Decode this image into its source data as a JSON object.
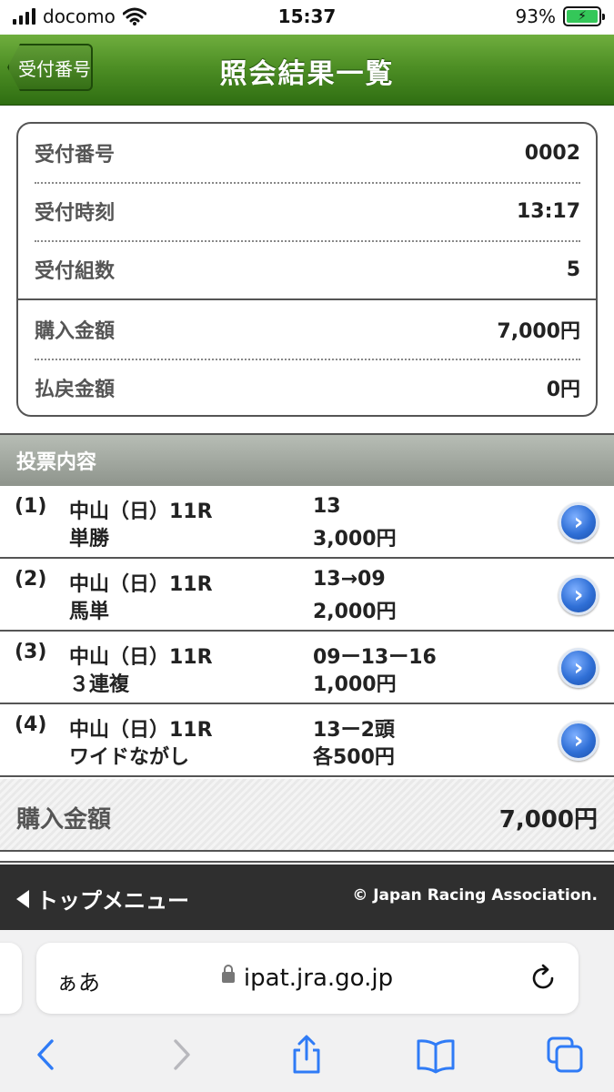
{
  "status": {
    "carrier": "docomo",
    "time": "15:37",
    "battery": "93%"
  },
  "header": {
    "back_label": "受付番号",
    "title": "照会結果一覧"
  },
  "summary": {
    "rows": [
      {
        "label": "受付番号",
        "value": "0002"
      },
      {
        "label": "受付時刻",
        "value": "13:17"
      },
      {
        "label": "受付組数",
        "value": "5"
      },
      {
        "label": "購入金額",
        "value": "7,000円"
      },
      {
        "label": "払戻金額",
        "value": "0円"
      }
    ]
  },
  "section": {
    "title": "投票内容"
  },
  "tickets": [
    {
      "no": "(1)",
      "race": "中山（日）11R",
      "kind": "単勝",
      "combo": "13",
      "amount": "3,000円"
    },
    {
      "no": "(2)",
      "race": "中山（日）11R",
      "kind": "馬単",
      "combo": "13→09",
      "amount": "2,000円"
    },
    {
      "no": "(3)",
      "race": "中山（日）11R",
      "kind": "３連複",
      "combo": "09ー13ー16",
      "amount": "1,000円"
    },
    {
      "no": "(4)",
      "race": "中山（日）11R",
      "kind": "ワイドながし",
      "combo": "13ー2頭",
      "amount": "各500円"
    }
  ],
  "total": {
    "label": "購入金額",
    "value": "7,000円"
  },
  "footer": {
    "top_menu": "トップメニュー",
    "copyright": "© Japan Racing Association."
  },
  "browser": {
    "aa": "ぁあ",
    "url": "ipat.jra.go.jp"
  },
  "colors": {
    "header_green": "#4e8f25",
    "go_blue": "#2f6fd6",
    "footer_bg": "#2f2f2f"
  }
}
